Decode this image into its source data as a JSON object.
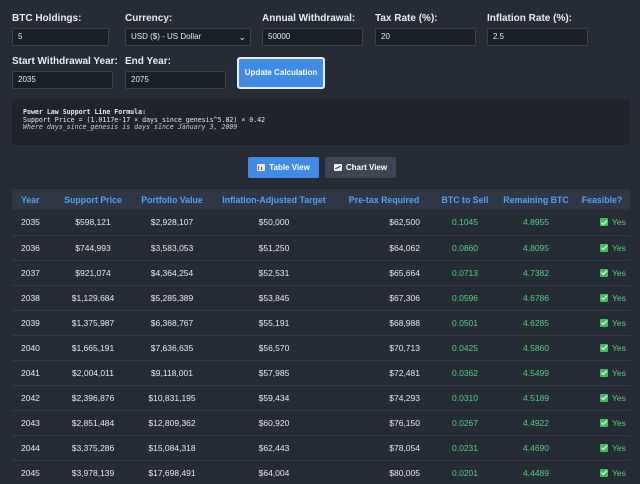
{
  "form": {
    "btc_holdings": {
      "label": "BTC Holdings:",
      "value": "5"
    },
    "currency": {
      "label": "Currency:",
      "value": "USD ($) - US Dollar"
    },
    "annual_withdrawal": {
      "label": "Annual Withdrawal:",
      "value": "50000"
    },
    "tax_rate": {
      "label": "Tax Rate (%):",
      "value": "20"
    },
    "inflation_rate": {
      "label": "Inflation Rate (%):",
      "value": "2.5"
    },
    "start_year": {
      "label": "Start Withdrawal Year:",
      "value": "2035"
    },
    "end_year": {
      "label": "End Year:",
      "value": "2075"
    },
    "update_label": "Update Calculation"
  },
  "formula": {
    "title": "Power Law Support Line Formula:",
    "line": "Support Price = (1.0117e-17 × days_since_genesis^5.82) × 0.42",
    "note": "Where days_since_genesis is days since January 3, 2009"
  },
  "views": {
    "table_label": "Table View",
    "chart_label": "Chart View"
  },
  "table": {
    "headers": [
      "Year",
      "Support Price",
      "Portfolio Value",
      "Inflation-Adjusted Target",
      "Pre-tax Required",
      "BTC to Sell",
      "Remaining BTC",
      "Feasible?"
    ],
    "rows": [
      [
        "2035",
        "$598,121",
        "$2,928,107",
        "$50,000",
        "$62,500",
        "0.1045",
        "4.8955",
        "Yes"
      ],
      [
        "2036",
        "$744,993",
        "$3,583,053",
        "$51,250",
        "$64,062",
        "0.0860",
        "4.8095",
        "Yes"
      ],
      [
        "2037",
        "$921,074",
        "$4,364,254",
        "$52,531",
        "$65,664",
        "0.0713",
        "4.7382",
        "Yes"
      ],
      [
        "2038",
        "$1,129,684",
        "$5,285,389",
        "$53,845",
        "$67,306",
        "0.0596",
        "4.6786",
        "Yes"
      ],
      [
        "2039",
        "$1,375,987",
        "$6,368,767",
        "$55,191",
        "$68,988",
        "0.0501",
        "4.6285",
        "Yes"
      ],
      [
        "2040",
        "$1,665,191",
        "$7,636,635",
        "$56,570",
        "$70,713",
        "0.0425",
        "4.5860",
        "Yes"
      ],
      [
        "2041",
        "$2,004,011",
        "$9,118,001",
        "$57,985",
        "$72,481",
        "0.0362",
        "4.5499",
        "Yes"
      ],
      [
        "2042",
        "$2,396,876",
        "$10,831,195",
        "$59,434",
        "$74,293",
        "0.0310",
        "4.5189",
        "Yes"
      ],
      [
        "2043",
        "$2,851,484",
        "$12,809,362",
        "$60,920",
        "$76,150",
        "0.0267",
        "4.4922",
        "Yes"
      ],
      [
        "2044",
        "$3,375,286",
        "$15,084,318",
        "$62,443",
        "$78,054",
        "0.0231",
        "4.4690",
        "Yes"
      ],
      [
        "2045",
        "$3,978,139",
        "$17,698,491",
        "$64,004",
        "$80,005",
        "0.0201",
        "4.4489",
        "Yes"
      ]
    ]
  }
}
